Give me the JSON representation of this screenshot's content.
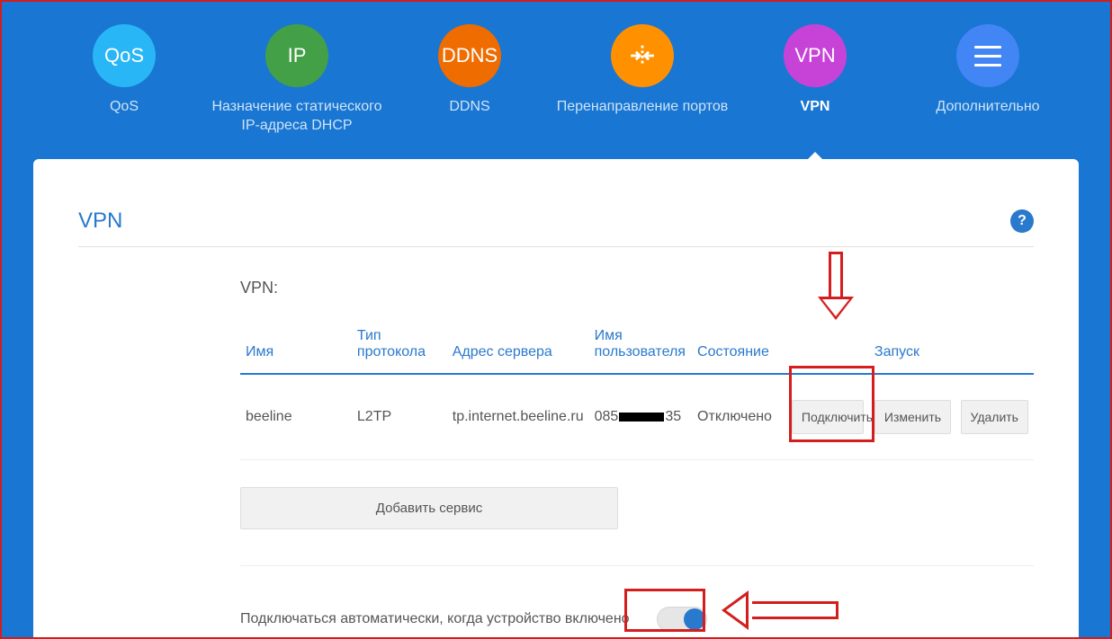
{
  "tabs": {
    "qos": {
      "icon_text": "QoS",
      "label": "QoS"
    },
    "ip": {
      "icon_text": "IP",
      "label": "Назначение статического IP-адреса DHCP"
    },
    "ddns": {
      "icon_text": "DDNS",
      "label": "DDNS"
    },
    "port": {
      "label": "Перенаправление портов"
    },
    "vpn": {
      "icon_text": "VPN",
      "label": "VPN"
    },
    "more": {
      "label": "Дополнительно"
    }
  },
  "panel": {
    "title": "VPN",
    "help_icon": "?",
    "section_label": "VPN:"
  },
  "table": {
    "headers": {
      "name": "Имя",
      "protocol": "Тип протокола",
      "server": "Адрес сервера",
      "user": "Имя пользователя",
      "status": "Состояние",
      "launch": "Запуск"
    },
    "rows": [
      {
        "name": "beeline",
        "protocol": "L2TP",
        "server": "tp.internet.beeline.ru",
        "user_prefix": "085",
        "user_suffix": "35",
        "status": "Отключено",
        "connect": "Подключить",
        "edit": "Изменить",
        "delete": "Удалить"
      }
    ],
    "add_service": "Добавить сервис"
  },
  "auto": {
    "label": "Подключаться автоматически, когда устройство включено",
    "enabled": true
  },
  "colors": {
    "brand_blue": "#1976d2",
    "link_blue": "#2979cc",
    "annotation_red": "#d41e1e"
  }
}
